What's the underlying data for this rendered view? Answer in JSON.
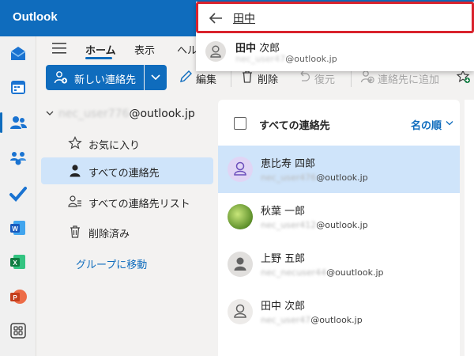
{
  "app": {
    "title": "Outlook"
  },
  "search": {
    "query": "田中",
    "suggestion": {
      "name_bold": "田中",
      "name_rest": " 次郎",
      "email_hidden": "nec_user47",
      "email_domain": "@outlook.jp"
    }
  },
  "tabs": {
    "home": "ホーム",
    "view": "表示",
    "help": "ヘルプ"
  },
  "ribbon": {
    "new_contact": "新しい連絡先",
    "edit": "編集",
    "delete": "削除",
    "restore": "復元",
    "add_to_contacts": "連絡先に追加"
  },
  "folders": {
    "account_hidden": "nec_user776",
    "account_domain": "@outlook.jp",
    "items": [
      {
        "label": "お気に入り"
      },
      {
        "label": "すべての連絡先"
      },
      {
        "label": "すべての連絡先リスト"
      },
      {
        "label": "削除済み"
      }
    ],
    "group_link": "グループに移動"
  },
  "list": {
    "title": "すべての連絡先",
    "sort": "名の順",
    "contacts": [
      {
        "name": "恵比寿 四郎",
        "email_hidden": "nec_user476",
        "email_domain": "@outlook.jp"
      },
      {
        "name": "秋葉 一郎",
        "email_hidden": "nec_user412",
        "email_domain": "@outlook.jp"
      },
      {
        "name": "上野 五郎",
        "email_hidden": "nec_necuser44",
        "email_domain": "@ouutlook.jp"
      },
      {
        "name": "田中 次郎",
        "email_hidden": "nec_user47",
        "email_domain": "@outlook.jp"
      }
    ]
  },
  "colors": {
    "brand": "#0f6cbd",
    "selected": "#cfe4fa",
    "highlight": "#d9232d"
  }
}
